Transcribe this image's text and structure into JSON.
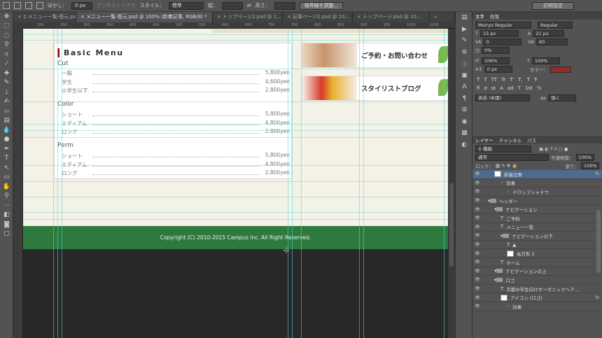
{
  "options_bar": {
    "feather_label": "ぼかし：",
    "feather_value": "0 px",
    "antialias_label": "アンチエイリアス",
    "style_label": "スタイル：",
    "style_value": "標準",
    "width_label": "幅：",
    "height_label": "高さ：",
    "refine_button": "境界線を調整...",
    "workspace_button": "初期設定"
  },
  "tabs": [
    {
      "label": "2.メニュー一覧-復元.psd"
    },
    {
      "label": "メニュー一覧-復元.psd @ 100% (新着記事, RGB/8) *"
    },
    {
      "label": "トップページ2.psd @ 1..."
    },
    {
      "label": "記事ページ2.psd @ 10..."
    },
    {
      "label": "トップページ.psd @ 10..."
    }
  ],
  "ruler": {
    "ticks": [
      "200",
      "250",
      "300",
      "350",
      "400",
      "450",
      "500",
      "550",
      "600",
      "650",
      "700",
      "750",
      "800",
      "850",
      "900",
      "950",
      "1000",
      "1050"
    ]
  },
  "canvas": {
    "menu_title": "Basic Menu",
    "sections": [
      {
        "name": "Cut",
        "items": [
          {
            "name": "一般",
            "price": "5,800yen"
          },
          {
            "name": "学生",
            "price": "4,600yen"
          },
          {
            "name": "小学生以下",
            "price": "2,800yen"
          }
        ]
      },
      {
        "name": "Color",
        "items": [
          {
            "name": "ショート",
            "price": "5,800yen"
          },
          {
            "name": "ミディアム",
            "price": "4,800yen"
          },
          {
            "name": "ロング",
            "price": "2,800yen"
          }
        ]
      },
      {
        "name": "Perm",
        "items": [
          {
            "name": "ショート",
            "price": "5,800yen"
          },
          {
            "name": "ミディアム",
            "price": "4,800yen"
          },
          {
            "name": "ロング",
            "price": "2,800yen"
          }
        ]
      }
    ],
    "banners": [
      {
        "text": "ご予約・お問い合わせ"
      },
      {
        "text": "スタイリストブログ"
      }
    ],
    "footer_text": "Copyright (C) 2010-2015 Campus inc. All Right Reserved."
  },
  "char_panel": {
    "tabs": [
      "文字",
      "段落"
    ],
    "font_family": "Meiryo Regular",
    "font_style": "Regular",
    "font_size": "15 px",
    "leading": "21 px",
    "kerning": "0",
    "tracking": "60",
    "tsume": "0%",
    "vscale": "106%",
    "hscale": "100%",
    "baseline": "0 px",
    "color_label": "カラー：",
    "lang": "英語 (米国)",
    "aa": "強く",
    "type_buttons": [
      "T",
      "T",
      "TT",
      "Tr",
      "T'",
      "T,",
      "T",
      "Ŧ"
    ],
    "glyph_buttons": [
      "fi",
      "ơ",
      "st",
      "A",
      "ad",
      "T",
      "1st",
      "½"
    ]
  },
  "layers_panel": {
    "tabs": [
      "レイヤー",
      "チャンネル",
      "パス"
    ],
    "filter_label": "種類",
    "blend_mode": "通常",
    "opacity_label": "不透明度：",
    "opacity_value": "100%",
    "lock_label": "ロック：",
    "fill_label": "塗り：",
    "fill_value": "100%",
    "layers": [
      {
        "name": "新着記事",
        "type": "text-thumb",
        "indent": 1,
        "selected": true,
        "fx": "fx"
      },
      {
        "name": "効果",
        "type": "effect",
        "indent": 2
      },
      {
        "name": "ドロップシャドウ",
        "type": "effect",
        "indent": 3
      },
      {
        "name": "ヘッダー",
        "type": "folder",
        "indent": 0
      },
      {
        "name": "ナビゲーション",
        "type": "folder",
        "indent": 1
      },
      {
        "name": "ご予約",
        "type": "text",
        "indent": 2
      },
      {
        "name": "メニュー一覧",
        "type": "text",
        "indent": 2
      },
      {
        "name": "ナビゲーションの下",
        "type": "folder",
        "indent": 2
      },
      {
        "name": "▲",
        "type": "text",
        "indent": 3
      },
      {
        "name": "長方形 2",
        "type": "shape",
        "indent": 3
      },
      {
        "name": "ホーム",
        "type": "text",
        "indent": 2
      },
      {
        "name": "ナビゲーションの上",
        "type": "folder",
        "indent": 1
      },
      {
        "name": "ロゴ",
        "type": "folder",
        "indent": 1
      },
      {
        "name": "京都の学生向けオーガニックヘア...",
        "type": "text",
        "indent": 2
      },
      {
        "name": "アイコン (ロゴ)",
        "type": "shape",
        "indent": 2,
        "fx": "fx"
      },
      {
        "name": "効果",
        "type": "effect",
        "indent": 3
      }
    ]
  }
}
